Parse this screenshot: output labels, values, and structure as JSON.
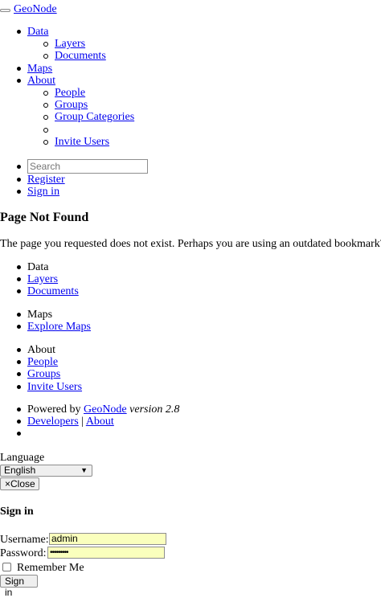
{
  "navbar": {
    "brand": "GeoNode",
    "menu": {
      "data": {
        "label": "Data",
        "items": [
          "Layers",
          "Documents"
        ]
      },
      "maps": {
        "label": "Maps"
      },
      "about": {
        "label": "About",
        "items": [
          "People",
          "Groups",
          "Group Categories",
          "",
          "Invite Users"
        ]
      }
    },
    "search_placeholder": "Search",
    "register": "Register",
    "sign_in": "Sign in"
  },
  "content": {
    "title": "Page Not Found",
    "message": "The page you requested does not exist. Perhaps you are using an outdated bookmark?"
  },
  "footer": {
    "data": {
      "heading": "Data",
      "links": [
        "Layers",
        "Documents"
      ]
    },
    "maps": {
      "heading": "Maps",
      "links": [
        "Explore Maps"
      ]
    },
    "about": {
      "heading": "About",
      "links": [
        "People",
        "Groups",
        "Invite Users"
      ]
    },
    "powered_by": "Powered by",
    "geonode_link": "GeoNode",
    "version": "version 2.8",
    "developers": "Developers",
    "separator": "|",
    "about_link": "About",
    "language_label": "Language",
    "language_selected": "English"
  },
  "modal": {
    "close_label": "×Close",
    "title": "Sign in",
    "username_label": "Username:",
    "username_value": "admin",
    "password_label": "Password:",
    "password_mask": "•••••••••",
    "remember_label": "Remember Me",
    "submit_label": "Sign in"
  }
}
